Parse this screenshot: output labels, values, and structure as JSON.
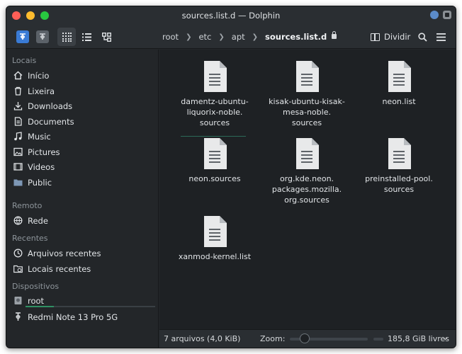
{
  "window": {
    "title": "sources.list.d — Dolphin"
  },
  "toolbar": {
    "breadcrumb": [
      "root",
      "etc",
      "apt",
      "sources.list.d"
    ],
    "split_label": "Dividir"
  },
  "sidebar": {
    "sections": {
      "locais": "Locais",
      "remoto": "Remoto",
      "recentes": "Recentes",
      "dispositivos": "Dispositivos"
    },
    "places": [
      {
        "label": "Início",
        "icon": "home-icon"
      },
      {
        "label": "Lixeira",
        "icon": "trash-icon"
      },
      {
        "label": "Downloads",
        "icon": "download-icon"
      },
      {
        "label": "Documents",
        "icon": "document-icon"
      },
      {
        "label": "Music",
        "icon": "music-icon"
      },
      {
        "label": "Pictures",
        "icon": "picture-icon"
      },
      {
        "label": "Videos",
        "icon": "video-icon"
      },
      {
        "label": "Public",
        "icon": "folder-icon"
      }
    ],
    "remote": [
      {
        "label": "Rede",
        "icon": "network-icon"
      }
    ],
    "recent": [
      {
        "label": "Arquivos recentes",
        "icon": "clock-icon"
      },
      {
        "label": "Locais recentes",
        "icon": "folder-clock-icon"
      }
    ],
    "devices": [
      {
        "label": "root",
        "icon": "drive-icon",
        "capacity_fraction": 0.22
      },
      {
        "label": "Redmi Note 13 Pro 5G",
        "icon": "phone-icon"
      }
    ]
  },
  "files": [
    {
      "name": "damentz-ubuntu-liquorix-noble.sources",
      "lines": [
        "damentz-ubuntu-",
        "liquorix-noble.",
        "sources"
      ]
    },
    {
      "name": "kisak-ubuntu-kisak-mesa-noble.sources",
      "lines": [
        "kisak-ubuntu-kisak-",
        "mesa-noble.",
        "sources"
      ]
    },
    {
      "name": "neon.list",
      "lines": [
        "neon.list"
      ]
    },
    {
      "name": "neon.sources",
      "lines": [
        "neon.sources"
      ]
    },
    {
      "name": "org.kde.neon.packages.mozilla.org.sources",
      "lines": [
        "org.kde.neon.",
        "packages.mozilla.",
        "org.sources"
      ]
    },
    {
      "name": "preinstalled-pool.sources",
      "lines": [
        "preinstalled-pool.",
        "sources"
      ]
    },
    {
      "name": "xanmod-kernel.list",
      "lines": [
        "xanmod-kernel.list"
      ]
    }
  ],
  "status": {
    "summary": "7 arquivos (4,0 KiB)",
    "zoom_label": "Zoom:",
    "free_space": "185,8 GiB livres"
  },
  "colors": {
    "accent": "#3a7bd5",
    "background": "#232629",
    "view_background": "#1e2124",
    "capacity": "#2f8f63"
  }
}
